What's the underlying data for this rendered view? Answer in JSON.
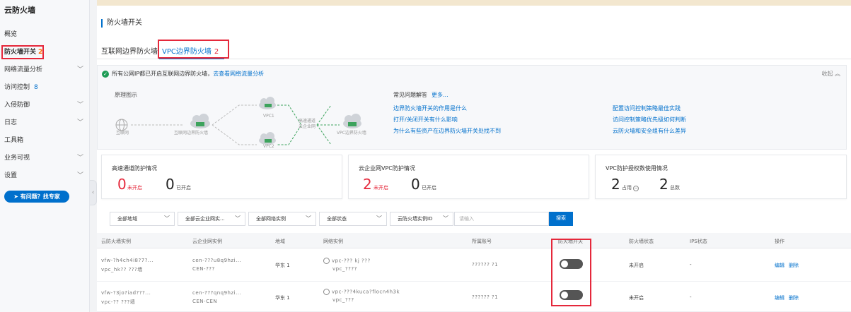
{
  "sidebar": {
    "title": "云防火墙",
    "items": [
      {
        "label": "概览"
      },
      {
        "label": "防火墙开关",
        "badge": "2"
      },
      {
        "label": "网络流量分析"
      },
      {
        "label": "访问控制",
        "badge": "8"
      },
      {
        "label": "入侵防御"
      },
      {
        "label": "日志"
      },
      {
        "label": "工具箱"
      },
      {
        "label": "业务可视"
      },
      {
        "label": "设置"
      }
    ],
    "help_button": "有问题？找专家"
  },
  "page": {
    "title": "防火墙开关",
    "tabs": [
      {
        "label": "互联网边界防火墙"
      },
      {
        "label": "VPC边界防火墙",
        "count": "2"
      }
    ]
  },
  "info": {
    "message": "所有公网IP都已开启互联网边界防火墙，",
    "link": "去查看网络流量分析",
    "collapse": "收起",
    "principle_title": "原理图示",
    "diagram": {
      "internet": "互联网",
      "internet_fw": "互联网边界防火墙",
      "vpc1": "VPC1",
      "vpc2": "VPC2",
      "express": "高速通道",
      "cen": "云企业网",
      "vpc_fw": "VPC边界防火墙"
    },
    "faq_title": "常见问题解答",
    "faq_more": "更多...",
    "faq": [
      "边界防火墙开关的作用是什么",
      "打开/关闭开关有什么影响",
      "为什么有些资产在边界防火墙开关处找不到",
      "配置访问控制策略最佳实践",
      "访问控制策略优先级如何判断",
      "云防火墙和安全组有什么差异"
    ]
  },
  "cards": {
    "express": {
      "title": "高速通道防护情况",
      "off": "0",
      "off_label": "未开启",
      "on": "0",
      "on_label": "已开启"
    },
    "cen": {
      "title": "云企业网VPC防护情况",
      "off": "2",
      "off_label": "未开启",
      "on": "0",
      "on_label": "已开启"
    },
    "license": {
      "title": "VPC防护授权数使用情况",
      "used": "2",
      "used_label": "占用",
      "total": "2",
      "total_label": "总数"
    }
  },
  "filters": {
    "region": "全部地域",
    "cen": "全部云企业网实...",
    "instance": "全部网络实例",
    "status": "全部状态",
    "fw_id": "云防火墙实例ID",
    "search_placeholder": "请输入",
    "search_button": "搜索"
  },
  "table": {
    "headers": [
      "云防火墙实例",
      "云企业网实例",
      "地域",
      "网络实例",
      "所属账号",
      "防火墙开关",
      "防火墙状态",
      "IPS状态",
      "操作"
    ],
    "rows": [
      {
        "fw1": "vfw-?h4ch4i8?7?...",
        "fw2": "vpc_hk?? ???墙",
        "cen1": "cen-???u8q9hzi...",
        "cen2": "CEN-???",
        "region": "华东 1",
        "net1": "vpc-??? kj ???",
        "net2": "vpc_????",
        "account": "?????? ?1",
        "status": "未开启",
        "ips": "-",
        "edit": "编辑",
        "delete": "删除"
      },
      {
        "fw1": "vfw-?3jo?iad???...",
        "fw2": "vpc-?? ???墙",
        "cen1": "cen-???qnq9hzi...",
        "cen2": "CEN-CEN",
        "region": "华东 1",
        "net1": "vpc-???4kuca?flocn4h3k",
        "net2": "vpc_???",
        "account": "?????? ?1",
        "status": "未开启",
        "ips": "-",
        "edit": "编辑",
        "delete": "删除"
      }
    ]
  }
}
